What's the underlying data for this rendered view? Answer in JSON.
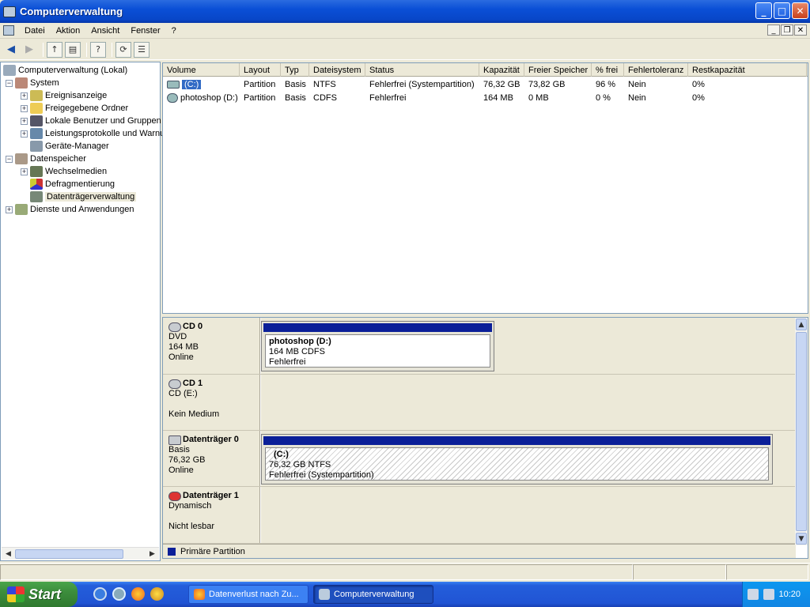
{
  "window": {
    "title": "Computerverwaltung"
  },
  "menu": [
    "Datei",
    "Aktion",
    "Ansicht",
    "Fenster",
    "?"
  ],
  "tree": {
    "root": "Computerverwaltung (Lokal)",
    "items": [
      {
        "label": "System",
        "level": 1,
        "expander": "-"
      },
      {
        "label": "Ereignisanzeige",
        "level": 2,
        "expander": "+"
      },
      {
        "label": "Freigegebene Ordner",
        "level": 2,
        "expander": "+"
      },
      {
        "label": "Lokale Benutzer und Gruppen",
        "level": 2,
        "expander": "+"
      },
      {
        "label": "Leistungsprotokolle und Warnungen",
        "level": 2,
        "expander": "+"
      },
      {
        "label": "Geräte-Manager",
        "level": 2,
        "expander": ""
      },
      {
        "label": "Datenspeicher",
        "level": 1,
        "expander": "-"
      },
      {
        "label": "Wechselmedien",
        "level": 2,
        "expander": "+"
      },
      {
        "label": "Defragmentierung",
        "level": 2,
        "expander": ""
      },
      {
        "label": "Datenträgerverwaltung",
        "level": 2,
        "expander": "",
        "selected": true
      },
      {
        "label": "Dienste und Anwendungen",
        "level": 1,
        "expander": "+"
      }
    ]
  },
  "volumes": {
    "headers": [
      "Volume",
      "Layout",
      "Typ",
      "Dateisystem",
      "Status",
      "Kapazität",
      "Freier Speicher",
      "% frei",
      "Fehlertoleranz",
      "Restkapazität"
    ],
    "rows": [
      [
        "(C:)",
        "Partition",
        "Basis",
        "NTFS",
        "Fehlerfrei (Systempartition)",
        "76,32 GB",
        "73,82 GB",
        "96 %",
        "Nein",
        "0%"
      ],
      [
        "photoshop (D:)",
        "Partition",
        "Basis",
        "CDFS",
        "Fehlerfrei",
        "164 MB",
        "0 MB",
        "0 %",
        "Nein",
        "0%"
      ]
    ]
  },
  "disks": [
    {
      "name": "CD 0",
      "type": "DVD",
      "size": "164 MB",
      "state": "Online",
      "partition": {
        "name": "photoshop  (D:)",
        "info": "164 MB CDFS",
        "status": "Fehlerfrei"
      }
    },
    {
      "name": "CD 1",
      "type": "CD (E:)",
      "size": "",
      "state": "Kein Medium"
    },
    {
      "name": "Datenträger 0",
      "type": "Basis",
      "size": "76,32 GB",
      "state": "Online",
      "partition": {
        "name": "(C:)",
        "info": "76,32 GB NTFS",
        "status": "Fehlerfrei (Systempartition)"
      }
    },
    {
      "name": "Datenträger 1",
      "type": "Dynamisch",
      "size": "",
      "state": "Nicht lesbar"
    }
  ],
  "legend": {
    "label": "Primäre Partition",
    "color": "#0b1f98"
  },
  "taskbar": {
    "start": "Start",
    "tasks": [
      "Datenverlust nach Zu...",
      "Computerverwaltung"
    ],
    "clock": "10:20"
  },
  "colors": {
    "selection": "#316AC5",
    "titlebar": "#0a4fd6",
    "taskbar": "#245edb",
    "start": "#3c8d3c"
  }
}
